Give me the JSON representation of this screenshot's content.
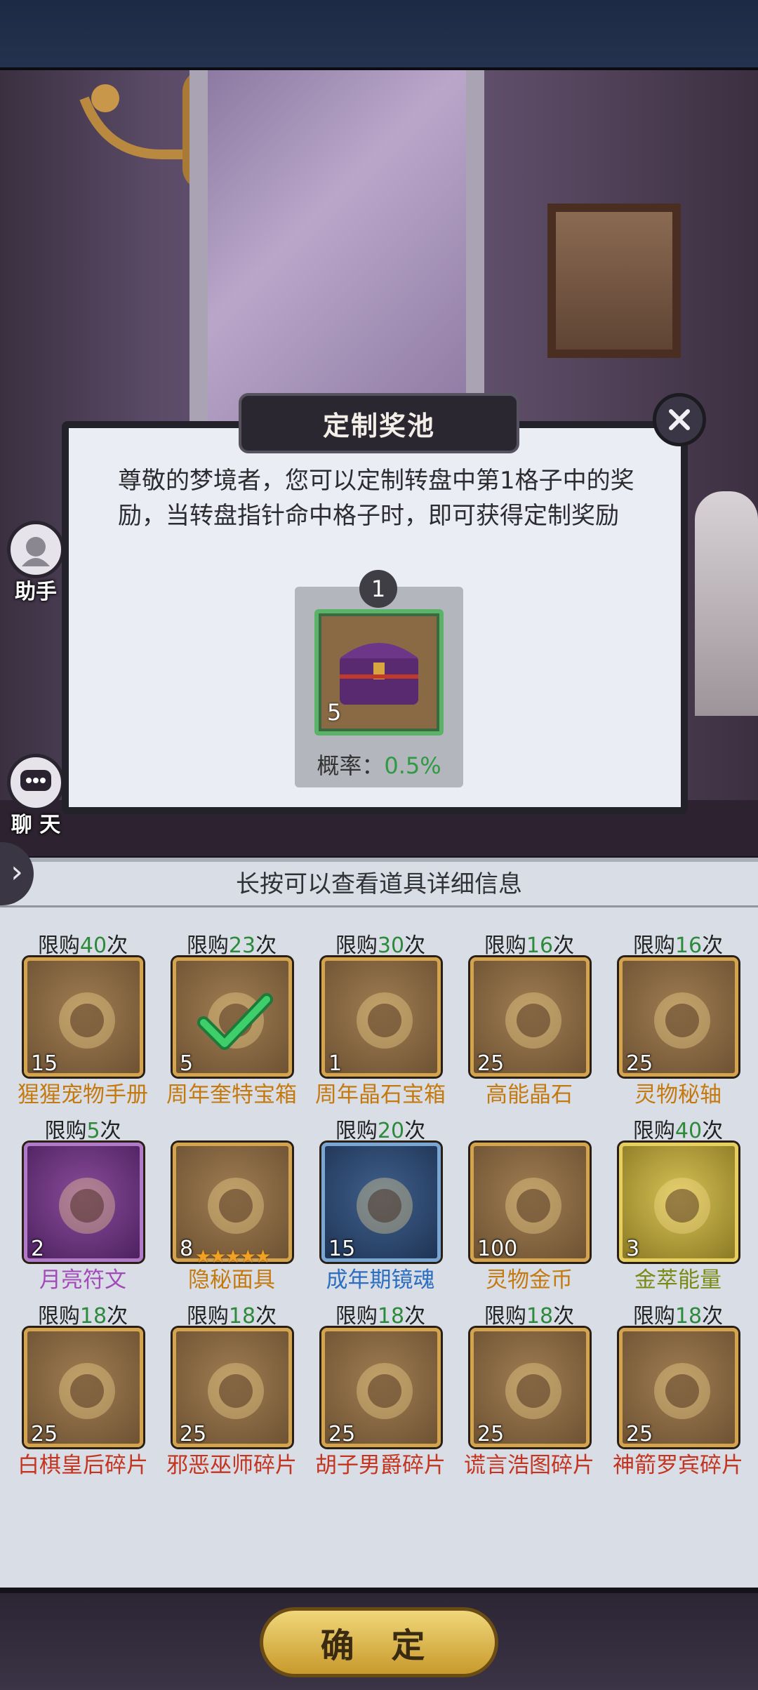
{
  "dialog": {
    "title": "定制奖池",
    "description": "尊敬的梦境者，您可以定制转盘中第1格子中的奖励，当转盘指针命中格子时，即可获得定制奖励",
    "slot": {
      "number": "1",
      "item_icon": "purple-treasure-chest-icon",
      "count": "5",
      "rate_label": "概率：",
      "rate_value": "0.5%"
    }
  },
  "side_buttons": {
    "assistant": "助手",
    "chat": "聊 天"
  },
  "hint": "长按可以查看道具详细信息",
  "items": [
    {
      "limit_prefix": "限购",
      "limit_num": "40",
      "limit_suffix": "次",
      "count": "15",
      "name": "猩猩宠物手册",
      "icon": "pet-manual-book-icon",
      "rarity": "orange"
    },
    {
      "limit_prefix": "限购",
      "limit_num": "23",
      "limit_suffix": "次",
      "count": "5",
      "name": "周年奎特宝箱",
      "icon": "anniversary-chest-selected-icon",
      "rarity": "orange"
    },
    {
      "limit_prefix": "限购",
      "limit_num": "30",
      "limit_suffix": "次",
      "count": "1",
      "name": "周年晶石宝箱",
      "icon": "gold-chest-icon",
      "rarity": "orange"
    },
    {
      "limit_prefix": "限购",
      "limit_num": "16",
      "limit_suffix": "次",
      "count": "25",
      "name": "高能晶石",
      "icon": "energy-crystal-icon",
      "rarity": "orange"
    },
    {
      "limit_prefix": "限购",
      "limit_num": "16",
      "limit_suffix": "次",
      "count": "25",
      "name": "灵物秘轴",
      "icon": "scroll-icon",
      "rarity": "orange"
    },
    {
      "limit_prefix": "限购",
      "limit_num": "5",
      "limit_suffix": "次",
      "count": "2",
      "name": "月亮符文",
      "icon": "moon-rune-icon",
      "rarity": "purple"
    },
    {
      "limit_prefix": "",
      "limit_num": "",
      "limit_suffix": "",
      "count": "8",
      "name": "隐秘面具",
      "icon": "mask-icon",
      "rarity": "orange",
      "stars": "★★★★★"
    },
    {
      "limit_prefix": "限购",
      "limit_num": "20",
      "limit_suffix": "次",
      "count": "15",
      "name": "成年期镜魂",
      "icon": "wolf-soul-icon",
      "rarity": "blue"
    },
    {
      "limit_prefix": "",
      "limit_num": "",
      "limit_suffix": "",
      "count": "100",
      "name": "灵物金币",
      "icon": "gold-coin-icon",
      "rarity": "orange"
    },
    {
      "limit_prefix": "限购",
      "limit_num": "40",
      "limit_suffix": "次",
      "count": "3",
      "name": "金萃能量",
      "icon": "energy-potion-icon",
      "rarity": "green"
    },
    {
      "limit_prefix": "限购",
      "limit_num": "18",
      "limit_suffix": "次",
      "count": "25",
      "name": "白棋皇后碎片",
      "icon": "white-queen-shard-icon",
      "rarity": "red"
    },
    {
      "limit_prefix": "限购",
      "limit_num": "18",
      "limit_suffix": "次",
      "count": "25",
      "name": "邪恶巫师碎片",
      "icon": "evil-wizard-shard-icon",
      "rarity": "red"
    },
    {
      "limit_prefix": "限购",
      "limit_num": "18",
      "limit_suffix": "次",
      "count": "25",
      "name": "胡子男爵碎片",
      "icon": "beard-baron-shard-icon",
      "rarity": "red"
    },
    {
      "limit_prefix": "限购",
      "limit_num": "18",
      "limit_suffix": "次",
      "count": "25",
      "name": "谎言浩图碎片",
      "icon": "liar-shard-icon",
      "rarity": "red"
    },
    {
      "limit_prefix": "限购",
      "limit_num": "18",
      "limit_suffix": "次",
      "count": "25",
      "name": "神箭罗宾碎片",
      "icon": "archer-robin-shard-icon",
      "rarity": "red"
    }
  ],
  "confirm": "确 定",
  "colors": {
    "limit_number": "#2e8a3b",
    "rate_value": "#2f9a43",
    "selected_border": "#5bb36a"
  }
}
